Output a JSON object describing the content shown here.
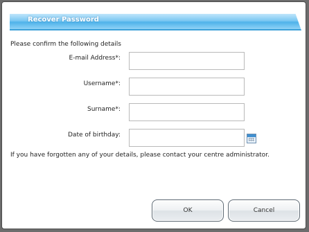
{
  "dialog": {
    "title": "Recover Password",
    "intro": "Please confirm the following details",
    "note": "If you have forgotten any of your details, please contact your centre administrator."
  },
  "form": {
    "email_label": "E-mail Address*:",
    "email_value": "",
    "username_label": "Username*:",
    "username_value": "",
    "surname_label": "Surname*:",
    "surname_value": "",
    "dob_label": "Date of birthday:",
    "dob_value": ""
  },
  "buttons": {
    "ok_label": "OK",
    "cancel_label": "Cancel"
  },
  "icons": {
    "calendar": "calendar-icon"
  },
  "colors": {
    "titlebar": "#5bb8ec",
    "overlay": "#6d6d6d"
  }
}
